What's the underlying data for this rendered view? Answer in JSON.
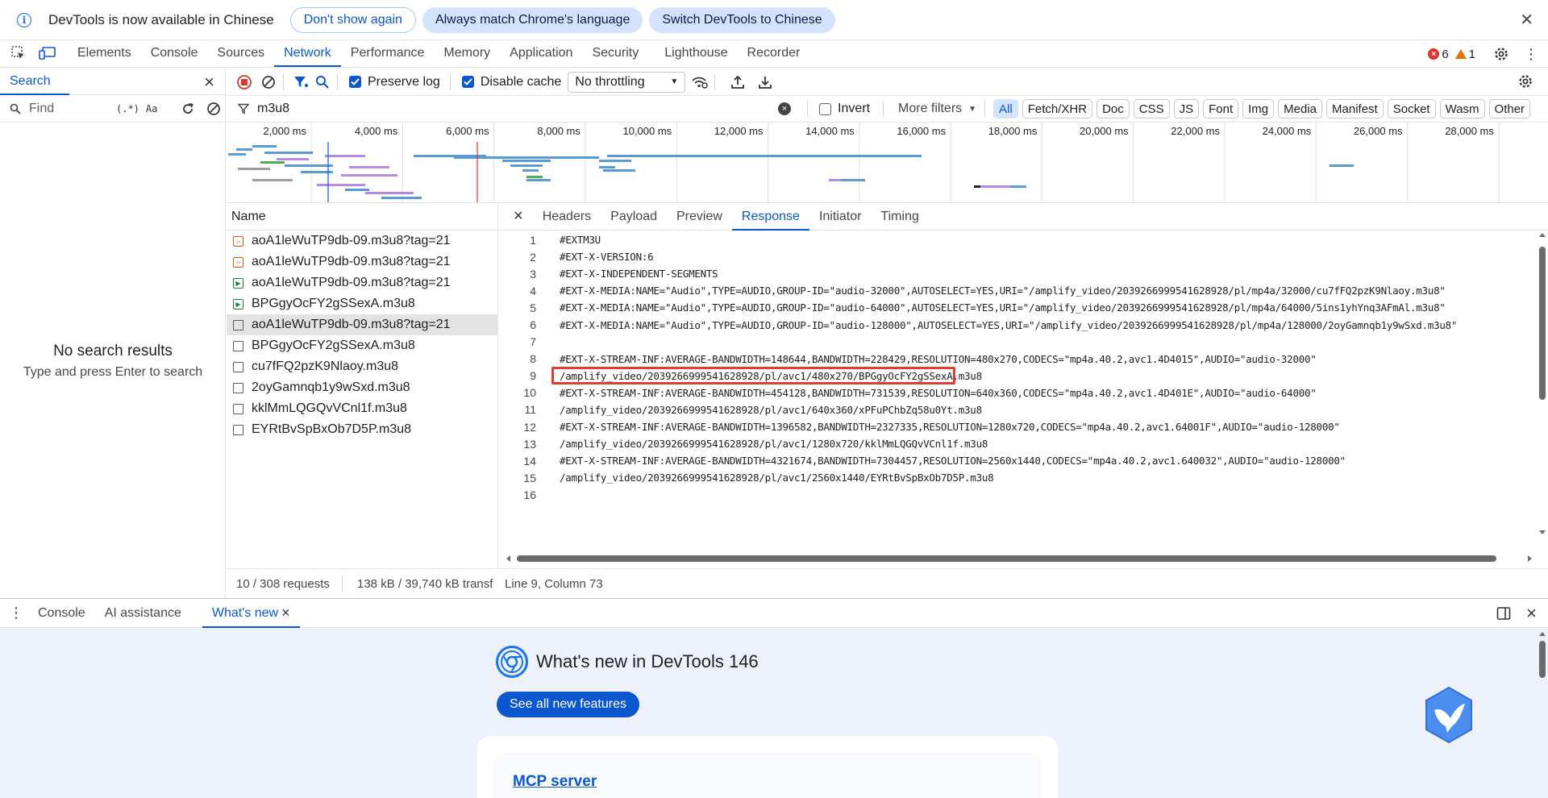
{
  "infobar": {
    "message": "DevTools is now available in Chinese",
    "btn_dont_show": "Don't show again",
    "btn_match": "Always match Chrome's language",
    "btn_switch": "Switch DevTools to Chinese",
    "close": "✕"
  },
  "main_tabs": [
    "Elements",
    "Console",
    "Sources",
    "Network",
    "Performance",
    "Memory",
    "Application",
    "Security",
    "Lighthouse",
    "Recorder"
  ],
  "active_main_tab": "Network",
  "error_count": "6",
  "warning_count": "1",
  "search_panel": {
    "tab": "Search",
    "find_placeholder": "Find",
    "regex_label": "(.*)",
    "case_label": "Aa",
    "empty_title": "No search results",
    "empty_hint": "Type and press Enter to search"
  },
  "network_toolbar": {
    "preserve_log": "Preserve log",
    "preserve_log_checked": true,
    "disable_cache": "Disable cache",
    "disable_cache_checked": true,
    "throttling": "No throttling"
  },
  "filter": {
    "value": "m3u8",
    "invert": "Invert",
    "more_filters": "More filters",
    "types": [
      "All",
      "Fetch/XHR",
      "Doc",
      "CSS",
      "JS",
      "Font",
      "Img",
      "Media",
      "Manifest",
      "Socket",
      "Wasm",
      "Other"
    ],
    "active_type": "All"
  },
  "timeline": {
    "ticks": [
      "2,000 ms",
      "4,000 ms",
      "6,000 ms",
      "8,000 ms",
      "10,000 ms",
      "12,000 ms",
      "14,000 ms",
      "16,000 ms",
      "18,000 ms",
      "20,000 ms",
      "22,000 ms",
      "24,000 ms",
      "26,000 ms",
      "28,000 ms"
    ]
  },
  "request_list": {
    "header": "Name",
    "rows": [
      {
        "name": "aoA1leWuTP9db-09.m3u8?tag=21",
        "type": "xhr"
      },
      {
        "name": "aoA1leWuTP9db-09.m3u8?tag=21",
        "type": "xhr"
      },
      {
        "name": "aoA1leWuTP9db-09.m3u8?tag=21",
        "type": "media"
      },
      {
        "name": "BPGgyOcFY2gSSexA.m3u8",
        "type": "media"
      },
      {
        "name": "aoA1leWuTP9db-09.m3u8?tag=21",
        "type": "doc",
        "selected": true
      },
      {
        "name": "BPGgyOcFY2gSSexA.m3u8",
        "type": "doc"
      },
      {
        "name": "cu7fFQ2pzK9Nlaoy.m3u8",
        "type": "doc"
      },
      {
        "name": "2oyGamnqb1y9wSxd.m3u8",
        "type": "doc"
      },
      {
        "name": "kklMmLQGQvVCnl1f.m3u8",
        "type": "doc"
      },
      {
        "name": "EYRtBvSpBxOb7D5P.m3u8",
        "type": "doc"
      }
    ]
  },
  "detail": {
    "tabs": [
      "Headers",
      "Payload",
      "Preview",
      "Response",
      "Initiator",
      "Timing"
    ],
    "active_tab": "Response",
    "highlight_line": 9,
    "lines": [
      "#EXTM3U",
      "#EXT-X-VERSION:6",
      "#EXT-X-INDEPENDENT-SEGMENTS",
      "#EXT-X-MEDIA:NAME=\"Audio\",TYPE=AUDIO,GROUP-ID=\"audio-32000\",AUTOSELECT=YES,URI=\"/amplify_video/2039266999541628928/pl/mp4a/32000/cu7fFQ2pzK9Nlaoy.m3u8\"",
      "#EXT-X-MEDIA:NAME=\"Audio\",TYPE=AUDIO,GROUP-ID=\"audio-64000\",AUTOSELECT=YES,URI=\"/amplify_video/2039266999541628928/pl/mp4a/64000/5ins1yhYnq3AFmAl.m3u8\"",
      "#EXT-X-MEDIA:NAME=\"Audio\",TYPE=AUDIO,GROUP-ID=\"audio-128000\",AUTOSELECT=YES,URI=\"/amplify_video/2039266999541628928/pl/mp4a/128000/2oyGamnqb1y9wSxd.m3u8\"",
      "",
      "#EXT-X-STREAM-INF:AVERAGE-BANDWIDTH=148644,BANDWIDTH=228429,RESOLUTION=480x270,CODECS=\"mp4a.40.2,avc1.4D4015\",AUDIO=\"audio-32000\"",
      "/amplify_video/2039266999541628928/pl/avc1/480x270/BPGgyOcFY2gSSexA.m3u8",
      "#EXT-X-STREAM-INF:AVERAGE-BANDWIDTH=454128,BANDWIDTH=731539,RESOLUTION=640x360,CODECS=\"mp4a.40.2,avc1.4D401E\",AUDIO=\"audio-64000\"",
      "/amplify_video/2039266999541628928/pl/avc1/640x360/xPFuPChbZq58u0Yt.m3u8",
      "#EXT-X-STREAM-INF:AVERAGE-BANDWIDTH=1396582,BANDWIDTH=2327335,RESOLUTION=1280x720,CODECS=\"mp4a.40.2,avc1.64001F\",AUDIO=\"audio-128000\"",
      "/amplify_video/2039266999541628928/pl/avc1/1280x720/kklMmLQGQvVCnl1f.m3u8",
      "#EXT-X-STREAM-INF:AVERAGE-BANDWIDTH=4321674,BANDWIDTH=7304457,RESOLUTION=2560x1440,CODECS=\"mp4a.40.2,avc1.640032\",AUDIO=\"audio-128000\"",
      "/amplify_video/2039266999541628928/pl/avc1/2560x1440/EYRtBvSpBxOb7D5P.m3u8",
      ""
    ]
  },
  "status": {
    "requests": "10 / 308 requests",
    "transferred": "138 kB / 39,740 kB transf",
    "cursor": "Line 9, Column 73"
  },
  "drawer": {
    "tabs": [
      "Console",
      "AI assistance",
      "What's new"
    ],
    "active_tab": "What's new",
    "whats_new_title": "What's new in DevTools 146",
    "see_all": "See all new features",
    "card_title": "MCP server"
  },
  "colors": {
    "accent": "#0b57d0",
    "error": "#dc362e",
    "warning": "#e37400",
    "highlight_box": "#e53935",
    "drawer_bg": "#edf2fa"
  }
}
